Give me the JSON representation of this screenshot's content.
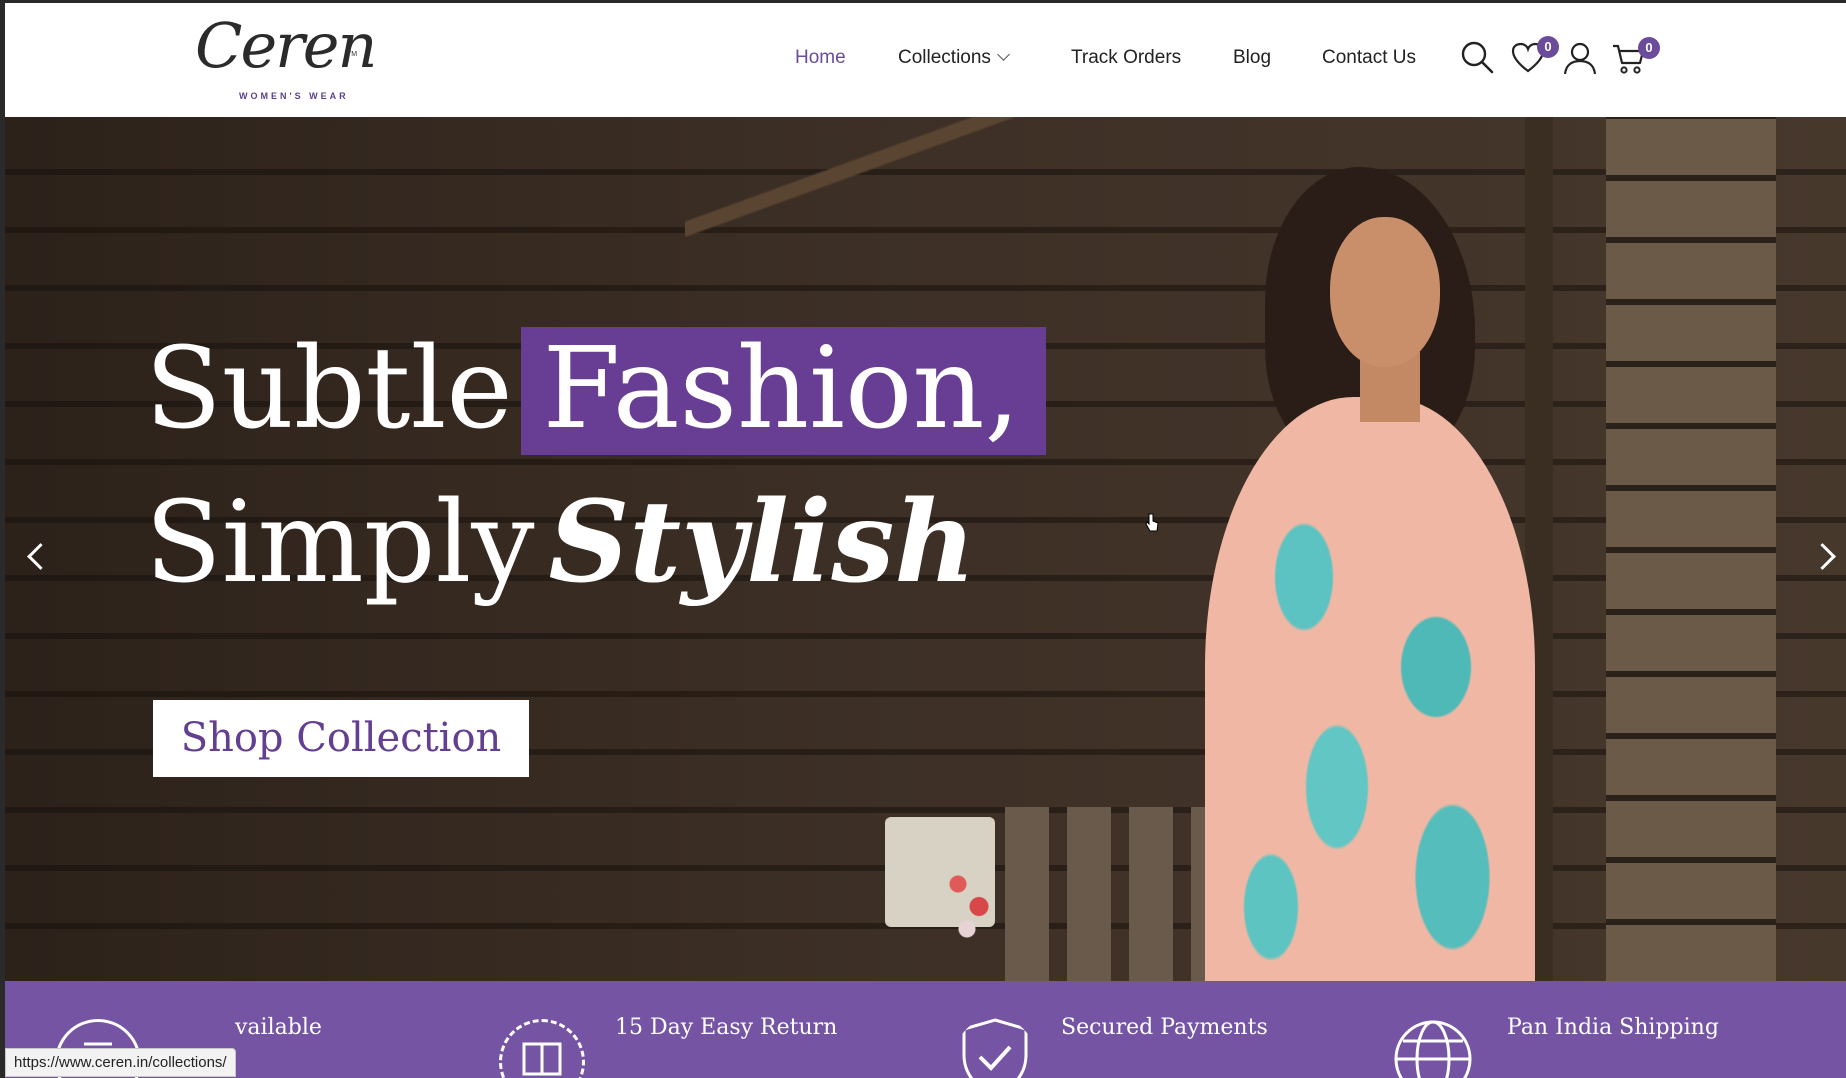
{
  "brand": {
    "logo_text": "Ceren",
    "logo_sub": "WOMEN'S WEAR",
    "logo_tm": "TM"
  },
  "nav": {
    "home": "Home",
    "collections": "Collections",
    "track_orders": "Track Orders",
    "blog": "Blog",
    "contact": "Contact Us"
  },
  "icons": {
    "search": "search-icon",
    "wishlist": "heart-icon",
    "account": "user-icon",
    "cart": "cart-icon"
  },
  "counts": {
    "wishlist": "0",
    "cart": "0"
  },
  "hero": {
    "line1_plain": "Subtle",
    "line1_highlight": "Fashion,",
    "line2_plain": "Simply",
    "line2_italic": "Stylish",
    "cta": "Shop Collection"
  },
  "features": [
    {
      "label": "vailable",
      "icon": "rupee-icon"
    },
    {
      "label": "15 Day Easy Return",
      "icon": "return-box-icon"
    },
    {
      "label": "Secured Payments",
      "icon": "shield-check-icon"
    },
    {
      "label": "Pan India Shipping",
      "icon": "globe-icon"
    }
  ],
  "status_bar": {
    "url": "https://www.ceren.in/collections/"
  },
  "colors": {
    "accent": "#673e93",
    "feature_bar": "#7454a3"
  }
}
